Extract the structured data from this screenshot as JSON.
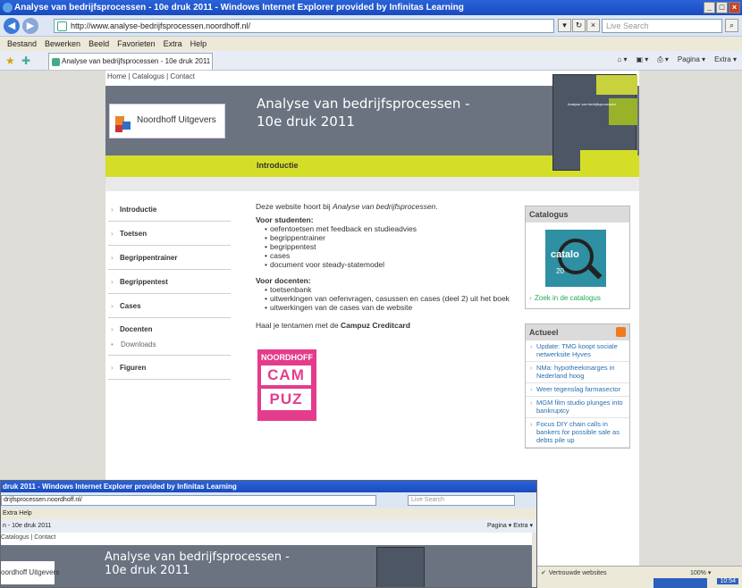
{
  "window": {
    "title": "Analyse van bedrijfsprocessen - 10e druk 2011 - Windows Internet Explorer provided by Infinitas Learning",
    "min": "_",
    "max": "□",
    "close": "×"
  },
  "browser": {
    "back": "◀",
    "forward": "▶",
    "url": "http://www.analyse-bedrijfsprocessen.noordhoff.nl/",
    "refresh": "↻",
    "stop": "×",
    "search_placeholder": "Live Search",
    "menu": [
      "Bestand",
      "Bewerken",
      "Beeld",
      "Favorieten",
      "Extra",
      "Help"
    ],
    "tab_label": "Analyse van bedrijfsprocessen - 10e druk 2011",
    "commands": [
      "Pagina ▾",
      "Extra ▾"
    ]
  },
  "site": {
    "topnav": "Home | Catalogus | Contact",
    "logo_text": "Noordhoff Uitgevers",
    "title_line1": "Analyse van bedrijfsprocessen -",
    "title_line2": "10e druk 2011",
    "section": "Introductie",
    "book_text": "Analyse van bedrijfsprocessen",
    "nav": {
      "introductie": "Introductie",
      "toetsen": "Toetsen",
      "begrippentrainer": "Begrippentrainer",
      "begrippentest": "Begrippentest",
      "cases": "Cases",
      "docenten": "Docenten",
      "downloads": "Downloads",
      "figuren": "Figuren"
    },
    "intro_prefix": "Deze website hoort bij ",
    "intro_book": "Analyse van bedrijfsprocessen",
    "intro_suffix": ".",
    "students_heading": "Voor studenten:",
    "students": [
      "oefentoetsen met feedback en studieadvies",
      "begrippentrainer",
      "begrippentest",
      "cases",
      "document voor steady-statemodel"
    ],
    "teachers_heading": "Voor docenten:",
    "teachers": [
      "toetsenbank",
      "uitwerkingen van oefenvragen, casussen en cases (deel 2) uit het boek",
      "uitwerkingen van de cases van de website"
    ],
    "campuz_prefix": "Haal je tentamen met de ",
    "campuz_link": "Campuz Creditcard",
    "campuz_logo": {
      "top": "NOORDHOFF",
      "mid": "CAM",
      "bot": "PUZ"
    },
    "catalogus": {
      "title": "Catalogus",
      "img_text": "catalo",
      "img_year": "20",
      "link": "Zoek in de catalogus"
    },
    "actueel": {
      "title": "Actueel",
      "items": [
        "Update: TMG koopt sociale netwerksite Hyves",
        "NMa: hypotheekmarges in Nederland hoog",
        "Weer tegenslag farmasector",
        "MGM film studio plunges into bankruptcy",
        "Focus DIY chain calls in bankers for possible sale as debts pile up"
      ]
    }
  },
  "lower_window": {
    "title": "druk 2011 - Windows Internet Explorer provided by Infinitas Learning",
    "url": "drijfsprocessen.noordhoff.nl/",
    "search": "Live Search",
    "menu": "Extra   Help",
    "tab": "n - 10e druk 2011",
    "commands": "Pagina ▾  Extra ▾",
    "topnav": "Catalogus | Contact",
    "logo_text": "oordhoff Uitgevers",
    "title_line1": "Analyse van bedrijfsprocessen -",
    "title_line2": "10e druk 2011"
  },
  "statusbar": {
    "zone": "Vertrouwde websites",
    "zoom": "100%  ▾",
    "clock": "10:54"
  }
}
